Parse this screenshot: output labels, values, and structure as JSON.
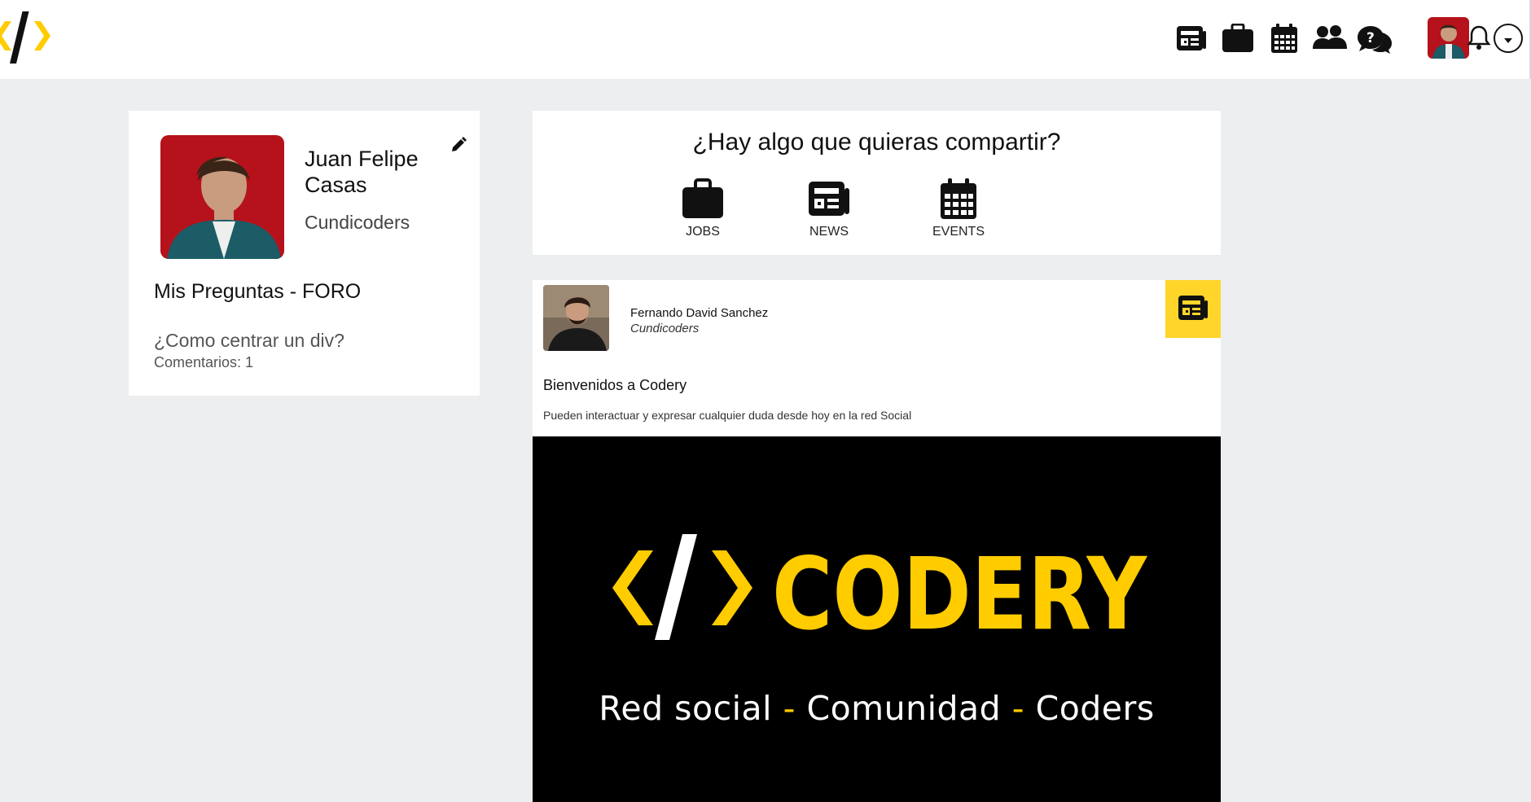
{
  "colors": {
    "accent": "#ffd52a",
    "background": "#eceef0",
    "brand_yellow": "#ffcc00"
  },
  "header": {
    "nav": [
      {
        "name": "news-nav",
        "icon": "newspaper-icon"
      },
      {
        "name": "jobs-nav",
        "icon": "briefcase-icon"
      },
      {
        "name": "events-nav",
        "icon": "calendar-icon"
      },
      {
        "name": "community-nav",
        "icon": "users-icon"
      },
      {
        "name": "forum-nav",
        "icon": "question-chat-icon"
      }
    ],
    "user_menu": {
      "avatar_icon": "user-avatar",
      "notifications_icon": "bell-icon",
      "dropdown_icon": "caret-down-icon"
    }
  },
  "profile": {
    "name": "Juan Felipe Casas",
    "organization": "Cundicoders",
    "section_title": "Mis Preguntas - FORO",
    "questions": [
      {
        "title": "¿Como centrar un div?",
        "comments": "Comentarios: 1"
      }
    ]
  },
  "share": {
    "title": "¿Hay algo que quieras compartir?",
    "options": [
      {
        "label": "JOBS",
        "icon": "briefcase-icon"
      },
      {
        "label": "NEWS",
        "icon": "newspaper-icon"
      },
      {
        "label": "EVENTS",
        "icon": "calendar-icon"
      }
    ]
  },
  "post": {
    "author": "Fernando David Sanchez",
    "organization": "Cundicoders",
    "type_icon": "newspaper-icon",
    "title": "Bienvenidos a Codery",
    "body": "Pueden interactuar y expresar cualquier duda desde hoy en la red Social",
    "image": {
      "brand": "CODERY",
      "tagline_parts": [
        "Red social",
        "Comunidad",
        "Coders"
      ],
      "separator": "-"
    }
  }
}
